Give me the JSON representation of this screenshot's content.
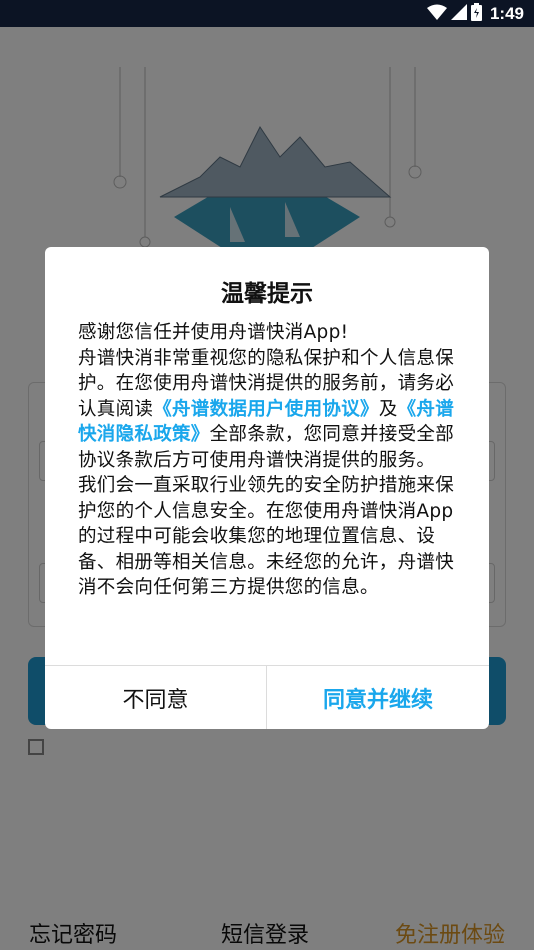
{
  "status_bar": {
    "time": "1:49",
    "icons": [
      "wifi-icon",
      "signal-icon",
      "battery-icon"
    ]
  },
  "background_screen": {
    "forgot_password": "忘记密码",
    "sms_login": "短信登录",
    "free_trial": "免注册体验",
    "colors": {
      "trial_link": "#d89524",
      "login_button": "#1f9bd2"
    }
  },
  "dialog": {
    "title": "温馨提示",
    "paragraphs": {
      "p1": "感谢您信任并使用舟谱快消App!",
      "p2_a": "舟谱快消非常重视您的隐私保护和个人信息保护。在您使用舟谱快消提供的服务前，请务必认真阅读",
      "p2_link1": "《舟谱数据用户使用协议》",
      "p2_b": "及",
      "p2_link2": "《舟谱快消隐私政策》",
      "p2_c": "全部条款，您同意并接受全部协议条款后方可使用舟谱快消提供的服务。",
      "p3": "我们会一直采取行业领先的安全防护措施来保护您的个人信息安全。在您使用舟谱快消App的过程中可能会收集您的地理位置信息、设备、相册等相关信息。未经您的允许，舟谱快消不会向任何第三方提供您的信息。"
    },
    "disagree_label": "不同意",
    "agree_label": "同意并继续",
    "colors": {
      "link": "#1aa7ec"
    }
  }
}
